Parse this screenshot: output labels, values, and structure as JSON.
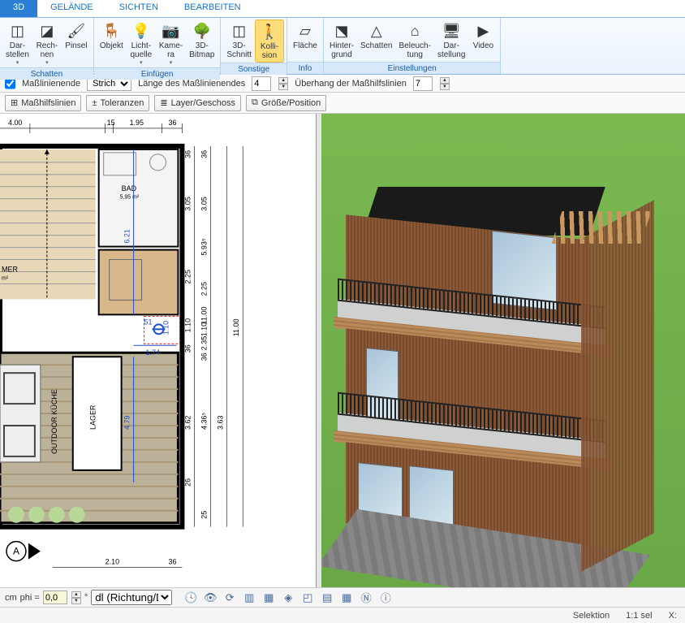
{
  "tabs": {
    "items": [
      "3D",
      "GELÄNDE",
      "SICHTEN",
      "BEARBEITEN"
    ],
    "active": 0
  },
  "ribbon": {
    "groups": [
      {
        "label": "Schatten",
        "items": [
          {
            "id": "darstellen",
            "label": "Dar-\nstellen",
            "icon": "cube-shadow",
            "drop": true
          },
          {
            "id": "rechnen",
            "label": "Rech-\nnen",
            "icon": "calc3d",
            "drop": true
          },
          {
            "id": "pinsel",
            "label": "Pinsel",
            "icon": "brush",
            "drop": false
          }
        ]
      },
      {
        "label": "Einfügen",
        "items": [
          {
            "id": "objekt",
            "label": "Objekt",
            "icon": "chair",
            "drop": false
          },
          {
            "id": "lichtquelle",
            "label": "Licht-\nquelle",
            "icon": "bulb",
            "drop": true
          },
          {
            "id": "kamera",
            "label": "Kame-\nra",
            "icon": "camera",
            "drop": true
          },
          {
            "id": "3d-bitmap",
            "label": "3D-\nBitmap",
            "icon": "tree",
            "drop": false
          }
        ]
      },
      {
        "label": "Sonstige",
        "items": [
          {
            "id": "3d-schnitt",
            "label": "3D-\nSchnitt",
            "icon": "section",
            "drop": false
          },
          {
            "id": "kollision",
            "label": "Kolli-\nsion",
            "icon": "person",
            "drop": false,
            "active": true
          }
        ]
      },
      {
        "label": "Info",
        "items": [
          {
            "id": "flaeche",
            "label": "Fläche",
            "icon": "area",
            "drop": false
          }
        ]
      },
      {
        "label": "Einstellungen",
        "items": [
          {
            "id": "hintergrund",
            "label": "Hinter-\ngrund",
            "icon": "horizon",
            "drop": false
          },
          {
            "id": "schatten",
            "label": "Schatten",
            "icon": "shadow",
            "drop": false
          },
          {
            "id": "beleuchtung",
            "label": "Beleuch-\ntung",
            "icon": "light",
            "drop": false
          },
          {
            "id": "einst-darst",
            "label": "Dar-\nstellung",
            "icon": "monitor",
            "drop": false
          },
          {
            "id": "video",
            "label": "Video",
            "icon": "play",
            "drop": false
          }
        ]
      }
    ]
  },
  "optbar": {
    "line_end_label": "Maßlinienende",
    "line_style": "Strich",
    "length_label": "Länge des Maßlinienendes",
    "length_value": "4",
    "overhang_label": "Überhang der Maßhilfslinien",
    "overhang_value": "7"
  },
  "toolbar": {
    "guide_lines": "Maßhilfslinien",
    "tolerances": "Toleranzen",
    "layer": "Layer/Geschoss",
    "size_pos": "Größe/Position"
  },
  "plan": {
    "dims_top": [
      "4.00",
      "15",
      "1.95",
      "36"
    ],
    "dims_right_outer": "11.00",
    "dims_right_mid": [
      "36",
      "3.05",
      "5.93⁵",
      "2.25",
      "11.00",
      "1.10",
      "2.35",
      "36"
    ],
    "dims_right_inner": [
      "36",
      "3.05",
      "2.25",
      "1.10",
      "36"
    ],
    "dims_bottom": [
      "2.10",
      "36"
    ],
    "dim_blue_1": "6.21",
    "dim_blue_2": "1.74",
    "dim_blue_3": "4.79",
    "dim_blue_4": "51",
    "dim_blue_5": "1.10",
    "dim_inner_h": [
      "3.63",
      "4.36⁵",
      "3.62",
      "26",
      "25"
    ],
    "rooms": {
      "bad": "BAD",
      "bad_area": "5,95 m²",
      "outdoor": "OUTDOOR KÜCHE",
      "lager": "LAGER",
      "mer": "MER",
      "mer_area": "m²"
    },
    "section_marker": "A"
  },
  "inputbar": {
    "unit": "cm",
    "phi_label": "phi =",
    "phi_value": "0,0",
    "deg": "°",
    "dir_mode": "dl (Richtung/Di"
  },
  "status": {
    "selection": "Selektion",
    "scale": "1:1 sel",
    "x": "X:"
  },
  "icons": {
    "cube-shadow": "◫",
    "calc3d": "◪",
    "brush": "🖌",
    "chair": "🪑",
    "bulb": "💡",
    "camera": "📷",
    "tree": "🌳",
    "section": "◫",
    "person": "🚶",
    "area": "▱",
    "horizon": "⬔",
    "shadow": "△",
    "light": "⌂",
    "monitor": "🖥",
    "play": "▶",
    "guide": "⊞",
    "plusminus": "±",
    "layers": "≣",
    "sizepos": "⧉",
    "clock": "🕓",
    "eye": "👁",
    "refresh": "⟳",
    "box1": "▥",
    "box2": "▦",
    "diamond": "◈",
    "sheet": "◰",
    "sheet2": "▤",
    "grid": "▦",
    "n": "Ⓝ",
    "i": "ⓘ"
  }
}
